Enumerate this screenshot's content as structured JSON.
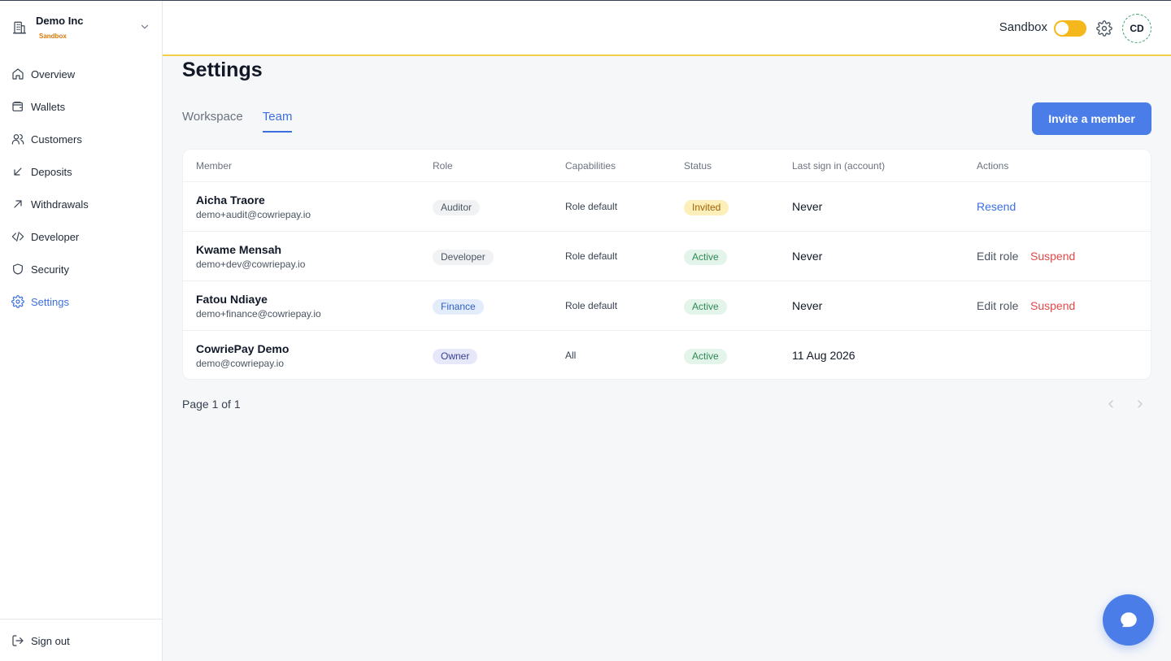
{
  "org": {
    "name": "Demo Inc",
    "badge": "Sandbox"
  },
  "sidebar": {
    "items": [
      {
        "label": "Overview",
        "icon": "home-icon"
      },
      {
        "label": "Wallets",
        "icon": "wallet-icon"
      },
      {
        "label": "Customers",
        "icon": "users-icon"
      },
      {
        "label": "Deposits",
        "icon": "arrow-down-left-icon"
      },
      {
        "label": "Withdrawals",
        "icon": "arrow-up-right-icon"
      },
      {
        "label": "Developer",
        "icon": "code-icon"
      },
      {
        "label": "Security",
        "icon": "shield-icon"
      },
      {
        "label": "Settings",
        "icon": "gear-icon",
        "active": true
      }
    ],
    "signout_label": "Sign out"
  },
  "topbar": {
    "sandbox_label": "Sandbox",
    "sandbox_on": true,
    "avatar_initials": "CD"
  },
  "page": {
    "title": "Settings",
    "tabs": [
      {
        "label": "Workspace"
      },
      {
        "label": "Team",
        "active": true
      }
    ],
    "invite_label": "Invite a member"
  },
  "table": {
    "headers": [
      "Member",
      "Role",
      "Capabilities",
      "Status",
      "Last sign in (account)",
      "Actions"
    ],
    "rows": [
      {
        "name": "Aicha Traore",
        "email": "demo+audit@cowriepay.io",
        "role": "Auditor",
        "capabilities": "Role default",
        "status": "Invited",
        "last_sign_in": "Never",
        "actions": [
          "Resend"
        ]
      },
      {
        "name": "Kwame Mensah",
        "email": "demo+dev@cowriepay.io",
        "role": "Developer",
        "capabilities": "Role default",
        "status": "Active",
        "last_sign_in": "Never",
        "actions": [
          "Edit role",
          "Suspend"
        ]
      },
      {
        "name": "Fatou Ndiaye",
        "email": "demo+finance@cowriepay.io",
        "role": "Finance",
        "capabilities": "Role default",
        "status": "Active",
        "last_sign_in": "Never",
        "actions": [
          "Edit role",
          "Suspend"
        ]
      },
      {
        "name": "CowriePay Demo",
        "email": "demo@cowriepay.io",
        "role": "Owner",
        "capabilities": "All",
        "status": "Active",
        "last_sign_in": "11 Aug 2026",
        "actions": []
      }
    ]
  },
  "pagination": {
    "label": "Page 1 of 1"
  },
  "colors": {
    "accent": "#4a7de8",
    "sandbox": "#f5b81c",
    "danger": "#e04848",
    "active_status": "#2f8a55",
    "invited_status": "#a16207"
  }
}
